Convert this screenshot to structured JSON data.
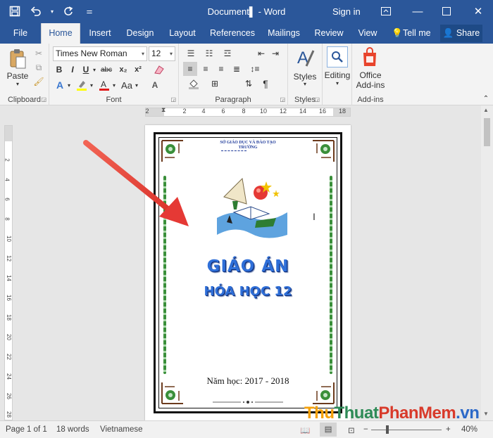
{
  "title_bar": {
    "doc_title": "Document▌ - Word",
    "signin": "Sign in"
  },
  "tabs": [
    "File",
    "Home",
    "Insert",
    "Design",
    "Layout",
    "References",
    "Mailings",
    "Review",
    "View"
  ],
  "tell_me": "Tell me",
  "share": "Share",
  "ribbon": {
    "clipboard": {
      "paste": "Paste",
      "label": "Clipboard"
    },
    "font": {
      "name": "Times New Roman",
      "size": "12",
      "label": "Font",
      "change_case": "Aa"
    },
    "paragraph": {
      "label": "Paragraph"
    },
    "styles": {
      "button": "Styles",
      "label": "Styles"
    },
    "editing": {
      "button": "Editing"
    },
    "addins": {
      "button_line1": "Office",
      "button_line2": "Add-ins",
      "label": "Add-ins"
    }
  },
  "ruler": {
    "h_ticks": [
      "2",
      "2",
      "4",
      "6",
      "8",
      "10",
      "12",
      "14",
      "16",
      "18"
    ],
    "v_ticks": [
      "2",
      "4",
      "6",
      "8",
      "10",
      "12",
      "14",
      "16",
      "18",
      "20",
      "22",
      "24",
      "26",
      "28"
    ]
  },
  "document": {
    "school_line1": "SỞ GIÁO DỤC VÀ ĐÀO TẠO",
    "school_line2": "TRƯỜNG",
    "title": "GIÁO ÁN",
    "subtitle": "HÓA HỌC 12",
    "year": "Năm học: 2017 - 2018"
  },
  "status": {
    "page": "Page 1 of 1",
    "words": "18 words",
    "language": "Vietnamese",
    "zoom": "40%"
  },
  "watermark": {
    "p1": "Thu",
    "p2": "Thuat",
    "p3": "PhanMem",
    "p4": ".vn"
  },
  "colors": {
    "word_blue": "#2b579a",
    "arrow_red": "#e53935",
    "title_blue": "#2f6fd8"
  }
}
